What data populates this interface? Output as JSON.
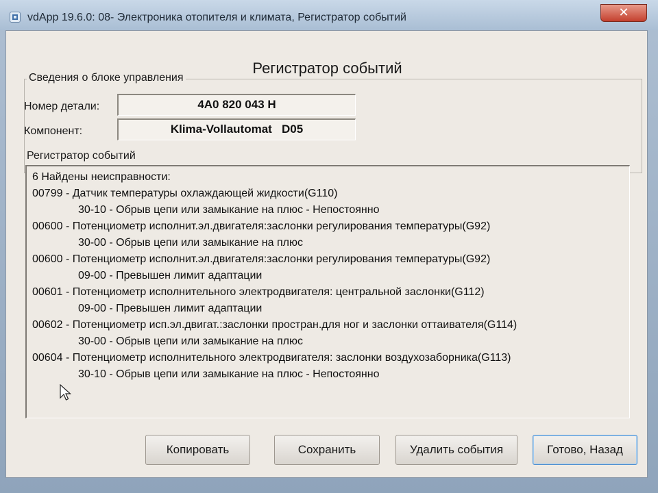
{
  "window": {
    "title": "vdApp 19.6.0: 08- Электроника отопителя и климата,  Регистратор событий",
    "close_glyph": "✕"
  },
  "page": {
    "heading": "Регистратор событий"
  },
  "ecu_info": {
    "legend": "Сведения о блоке управления",
    "part_number_label": "Номер детали:",
    "part_number_value": "4A0 820 043 H",
    "component_label": "Компонент:",
    "component_value": "Klima-Vollautomat   D05"
  },
  "event_log": {
    "label": "Регистратор событий",
    "lines": [
      {
        "text": "6 Найдены неисправности:",
        "indent": false
      },
      {
        "text": "00799 - Датчик температуры охлаждающей жидкости(G110)",
        "indent": false
      },
      {
        "text": "30-10 - Обрыв цепи или замыкание на плюс - Непостоянно",
        "indent": true
      },
      {
        "text": "00600 - Потенциометр исполнит.эл.двигателя:заслонки регулирования температуры(G92)",
        "indent": false
      },
      {
        "text": "30-00 - Обрыв цепи или замыкание на плюс",
        "indent": true
      },
      {
        "text": "00600 - Потенциометр исполнит.эл.двигателя:заслонки регулирования температуры(G92)",
        "indent": false
      },
      {
        "text": "09-00 - Превышен лимит адаптации",
        "indent": true
      },
      {
        "text": "00601 - Потенциометр исполнительного электродвигателя: центральной заслонки(G112)",
        "indent": false
      },
      {
        "text": "09-00 - Превышен лимит адаптации",
        "indent": true
      },
      {
        "text": "00602 - Потенциометр исп.эл.двигат.:заслонки простран.для ног и заслонки оттаивателя(G114)",
        "indent": false
      },
      {
        "text": "30-00 - Обрыв цепи или замыкание на плюс",
        "indent": true
      },
      {
        "text": "00604 - Потенциометр исполнительного электродвигателя: заслонки воздухозаборника(G113)",
        "indent": false
      },
      {
        "text": "30-10 - Обрыв цепи или замыкание на плюс - Непостоянно",
        "indent": true
      }
    ]
  },
  "buttons": {
    "copy": "Копировать",
    "save": "Сохранить",
    "delete": "Удалить события",
    "done": "Готово, Назад"
  }
}
